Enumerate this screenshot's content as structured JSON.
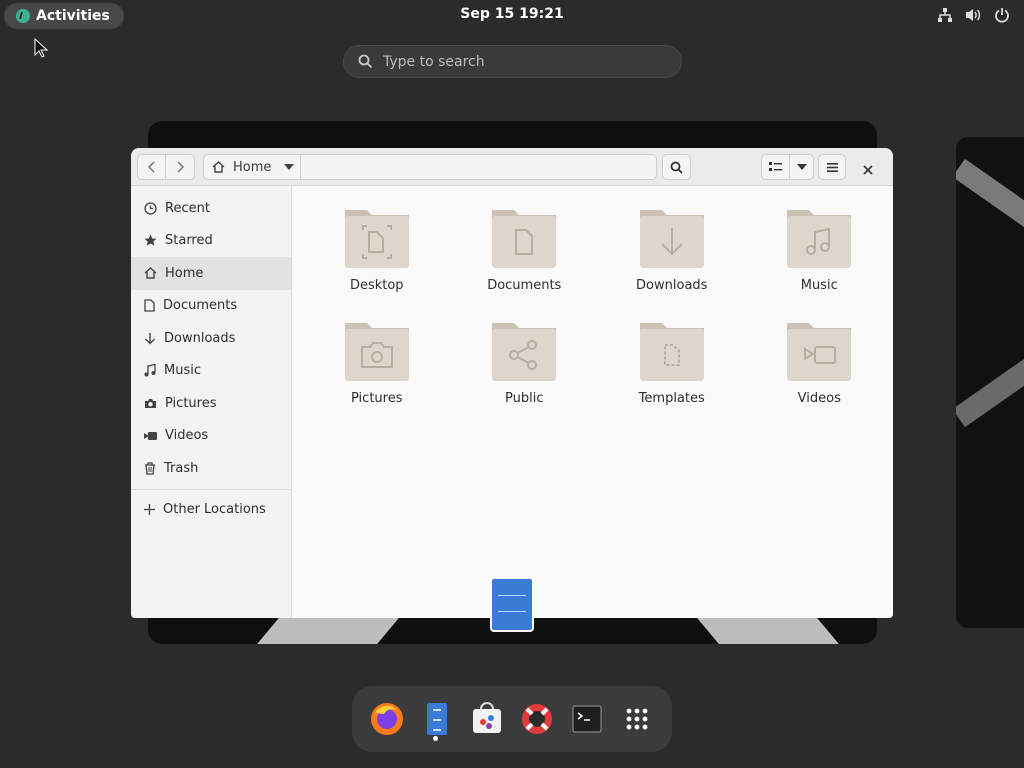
{
  "topbar": {
    "activities_label": "Activities",
    "clock": "Sep 15  19:21",
    "tray_icons": [
      "network-icon",
      "volume-icon",
      "power-icon"
    ]
  },
  "search": {
    "placeholder": "Type to search"
  },
  "files_window": {
    "location": "Home",
    "sidebar": [
      {
        "label": "Recent",
        "icon": "clock-icon"
      },
      {
        "label": "Starred",
        "icon": "star-icon"
      },
      {
        "label": "Home",
        "icon": "home-icon",
        "active": true
      },
      {
        "label": "Documents",
        "icon": "document-icon"
      },
      {
        "label": "Downloads",
        "icon": "download-icon"
      },
      {
        "label": "Music",
        "icon": "music-icon"
      },
      {
        "label": "Pictures",
        "icon": "camera-icon"
      },
      {
        "label": "Videos",
        "icon": "video-icon"
      },
      {
        "label": "Trash",
        "icon": "trash-icon"
      }
    ],
    "other_locations": "Other Locations",
    "folders": [
      {
        "label": "Desktop",
        "icon": "desktop-folder-icon"
      },
      {
        "label": "Documents",
        "icon": "documents-folder-icon"
      },
      {
        "label": "Downloads",
        "icon": "downloads-folder-icon"
      },
      {
        "label": "Music",
        "icon": "music-folder-icon"
      },
      {
        "label": "Pictures",
        "icon": "pictures-folder-icon"
      },
      {
        "label": "Public",
        "icon": "public-folder-icon"
      },
      {
        "label": "Templates",
        "icon": "templates-folder-icon"
      },
      {
        "label": "Videos",
        "icon": "videos-folder-icon"
      }
    ]
  },
  "dock": [
    "firefox-icon",
    "files-icon",
    "software-icon",
    "help-icon",
    "terminal-icon",
    "app-grid-icon"
  ],
  "colors": {
    "background": "#2b2b2b",
    "folder": "#d8d0c4",
    "accent": "#3a7bd5"
  }
}
